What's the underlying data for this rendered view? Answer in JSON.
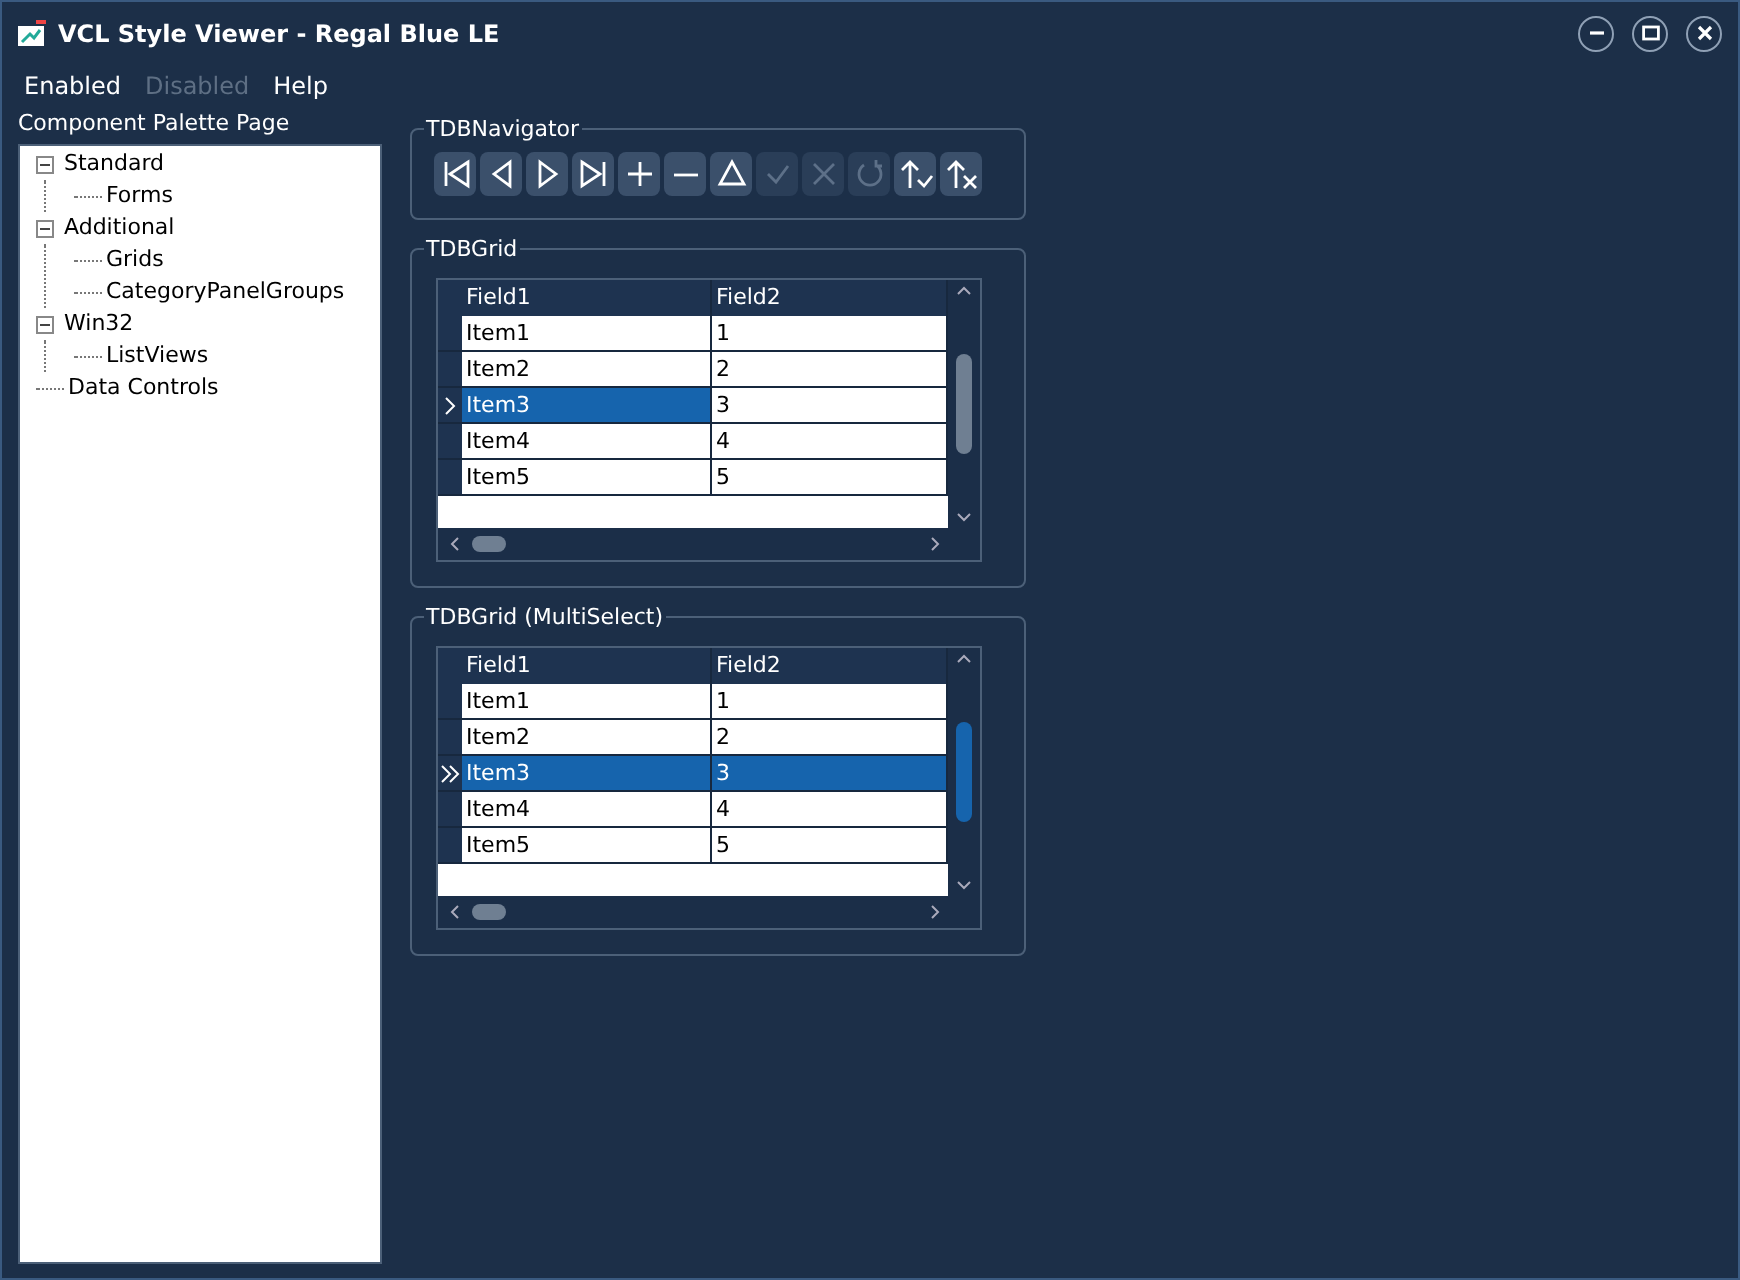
{
  "window": {
    "title": "VCL Style Viewer - Regal Blue LE"
  },
  "menu": [
    {
      "label": "Enabled",
      "disabled": false
    },
    {
      "label": "Disabled",
      "disabled": true
    },
    {
      "label": "Help",
      "disabled": false
    }
  ],
  "tree": {
    "title": "Component Palette Page",
    "items": [
      {
        "label": "Standard",
        "expanded": true,
        "children": [
          {
            "label": "Forms"
          }
        ]
      },
      {
        "label": "Additional",
        "expanded": true,
        "children": [
          {
            "label": "Grids"
          },
          {
            "label": "CategoryPanelGroups"
          }
        ]
      },
      {
        "label": "Win32",
        "expanded": true,
        "children": [
          {
            "label": "ListViews"
          }
        ]
      },
      {
        "label": "Data Controls"
      }
    ]
  },
  "navigator": {
    "title": "TDBNavigator",
    "buttons": [
      {
        "kind": "first",
        "disabled": false
      },
      {
        "kind": "prior",
        "disabled": false
      },
      {
        "kind": "next",
        "disabled": false
      },
      {
        "kind": "last",
        "disabled": false
      },
      {
        "kind": "insert",
        "disabled": false
      },
      {
        "kind": "delete",
        "disabled": false
      },
      {
        "kind": "edit",
        "disabled": false
      },
      {
        "kind": "post",
        "disabled": true
      },
      {
        "kind": "cancel",
        "disabled": true
      },
      {
        "kind": "refresh",
        "disabled": true
      },
      {
        "kind": "applyupdates",
        "disabled": false
      },
      {
        "kind": "cancelupdates",
        "disabled": false
      }
    ]
  },
  "grids": [
    {
      "title": "TDBGrid",
      "multi_select": false,
      "columns": [
        "Field1",
        "Field2"
      ],
      "rows": [
        {
          "cells": [
            "Item1",
            "1"
          ],
          "selected": false
        },
        {
          "cells": [
            "Item2",
            "2"
          ],
          "selected": false
        },
        {
          "cells": [
            "Item3",
            "3"
          ],
          "selected": true
        },
        {
          "cells": [
            "Item4",
            "4"
          ],
          "selected": false
        },
        {
          "cells": [
            "Item5",
            "5"
          ],
          "selected": false
        }
      ]
    },
    {
      "title": "TDBGrid (MultiSelect)",
      "multi_select": true,
      "columns": [
        "Field1",
        "Field2"
      ],
      "rows": [
        {
          "cells": [
            "Item1",
            "1"
          ],
          "selected": false
        },
        {
          "cells": [
            "Item2",
            "2"
          ],
          "selected": false
        },
        {
          "cells": [
            "Item3",
            "3"
          ],
          "selected": true
        },
        {
          "cells": [
            "Item4",
            "4"
          ],
          "selected": false
        },
        {
          "cells": [
            "Item5",
            "5"
          ],
          "selected": false
        }
      ]
    }
  ]
}
